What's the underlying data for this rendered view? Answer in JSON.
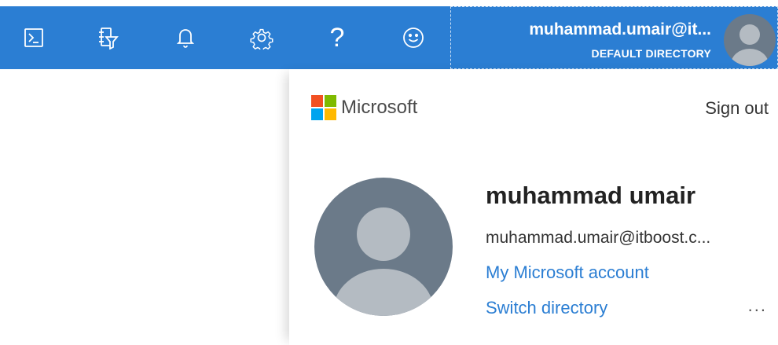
{
  "topbar": {
    "icons": [
      {
        "name": "cloud-shell-icon"
      },
      {
        "name": "directory-filter-icon"
      },
      {
        "name": "notifications-bell-icon"
      },
      {
        "name": "settings-gear-icon"
      },
      {
        "name": "help-question-icon",
        "glyph": "?"
      },
      {
        "name": "feedback-smiley-icon"
      }
    ],
    "account": {
      "email": "muhammad.umair@it...",
      "directory": "DEFAULT DIRECTORY"
    }
  },
  "colors": {
    "topbar": "#2b7ed3",
    "link": "#2b7ed3",
    "avatar_bg": "#6b7a89",
    "avatar_fg": "#b4bbc2"
  },
  "panel": {
    "brand": "Microsoft",
    "sign_out": "Sign out",
    "user_name": "muhammad umair",
    "user_email": "muhammad.umair@itboost.c...",
    "my_account_link": "My Microsoft account",
    "switch_directory_link": "Switch directory",
    "more": "..."
  }
}
